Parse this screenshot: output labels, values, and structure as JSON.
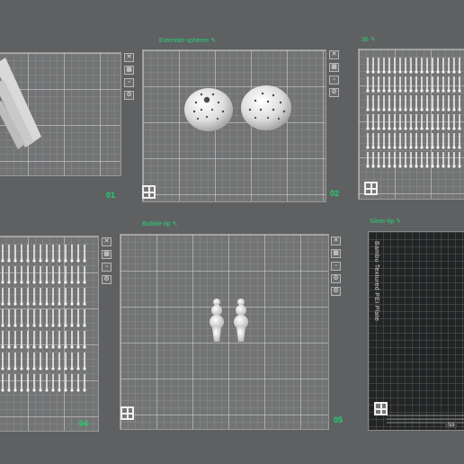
{
  "plates": [
    {
      "index": 1,
      "name": "",
      "number": "01"
    },
    {
      "index": 2,
      "name": "Extender-spheres",
      "number": "02"
    },
    {
      "index": 3,
      "name": "36",
      "number": ""
    },
    {
      "index": 4,
      "name": "",
      "number": "04"
    },
    {
      "index": 5,
      "name": "Bubble-tip",
      "number": "05"
    },
    {
      "index": 6,
      "name": "Silver-tip",
      "number": "",
      "surface_label": "Bambu Textured PEI Plate",
      "corner_tag": "S3"
    }
  ],
  "icons": {
    "edit": "pencil-icon",
    "close": "close-icon",
    "lock": "lock-icon",
    "settings": "gear-icon",
    "arrange": "arrange-icon"
  },
  "colors": {
    "accent": "#1fd36e",
    "background": "#5f6061",
    "plate": "#737475",
    "model": "#e6e6e6"
  }
}
